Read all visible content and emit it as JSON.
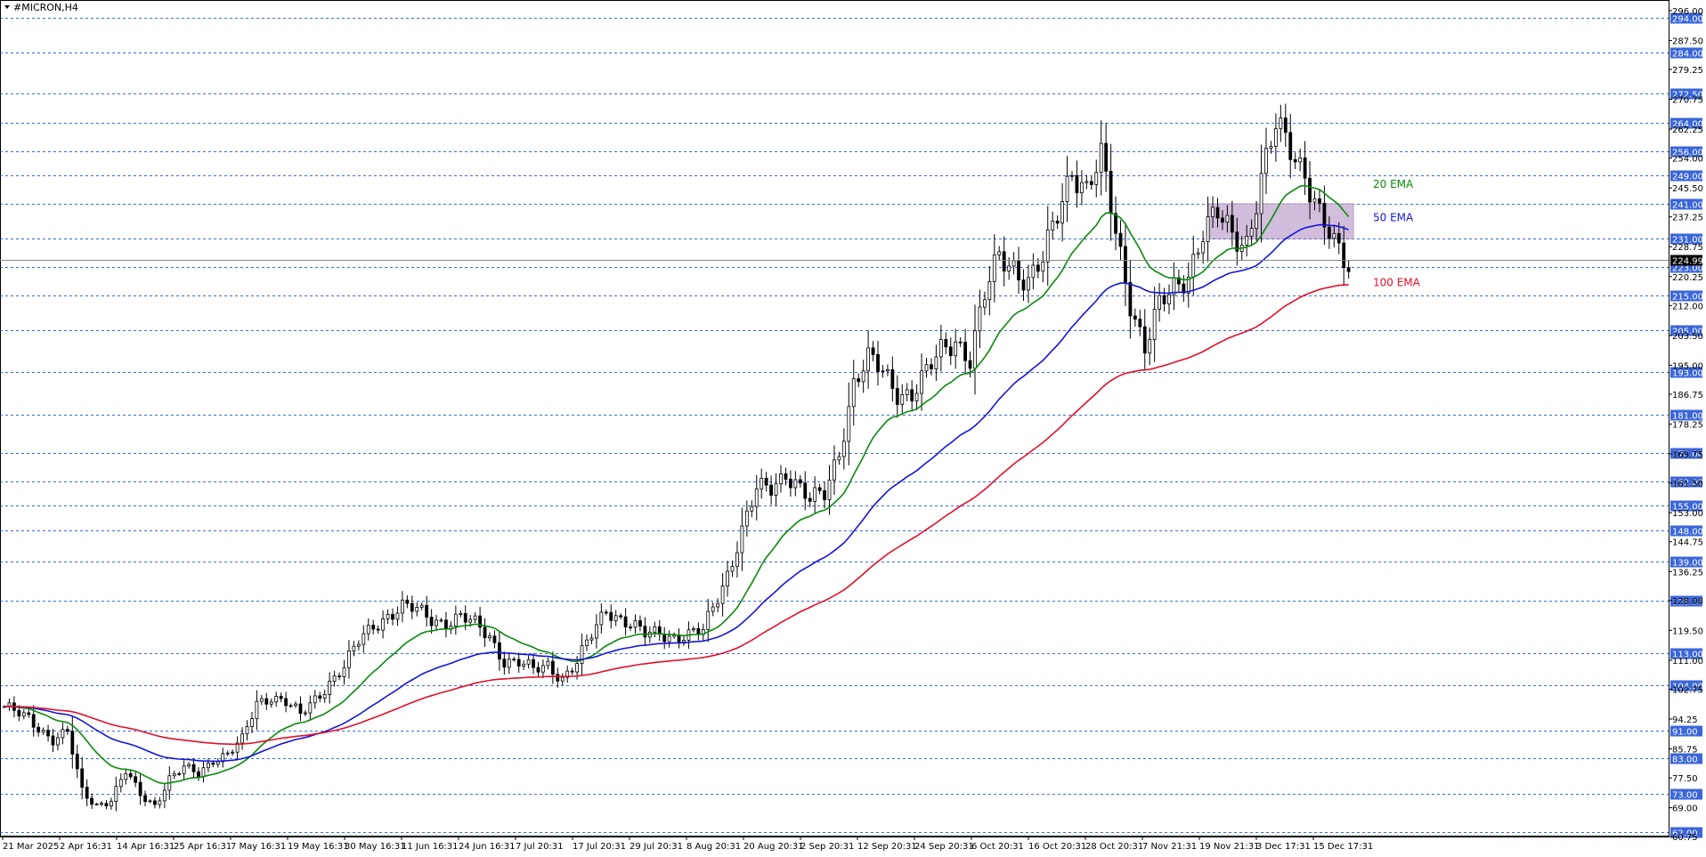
{
  "window": {
    "title": "#MICRON,H4",
    "menu_icon": "triangle-down-icon"
  },
  "colors": {
    "background": "#ffffff",
    "grid_level": "#1f4fd6",
    "level_label_bg": "#3a66d8",
    "candle": "#000000",
    "ema20": "#0a8a0a",
    "ema50": "#1515d8",
    "ema100": "#e0102a",
    "zone_fill": "#c9b3d6",
    "zone_stroke": "#8a6aa0"
  },
  "chart_data": {
    "type": "candlestick",
    "symbol": "#MICRON",
    "timeframe": "H4",
    "ylim": [
      60.8,
      298.5
    ],
    "y_ticks": [
      "296.00",
      "287.50",
      "279.25",
      "270.75",
      "262.25",
      "254.00",
      "245.50",
      "237.25",
      "228.75",
      "220.25",
      "212.00",
      "203.50",
      "195.00",
      "186.75",
      "178.25",
      "169.75",
      "161.50",
      "153.00",
      "144.75",
      "136.25",
      "128.00",
      "119.50",
      "111.00",
      "102.75",
      "94.25",
      "85.75",
      "77.50",
      "69.00",
      "60.75"
    ],
    "levels": [
      "294.00",
      "284.00",
      "272.50",
      "264.00",
      "256.00",
      "249.00",
      "241.00",
      "231.00",
      "223.00",
      "215.00",
      "205.00",
      "193.00",
      "181.00",
      "170.00",
      "162.00",
      "155.00",
      "148.00",
      "139.00",
      "128.00",
      "113.00",
      "104.00",
      "91.00",
      "83.00",
      "73.00",
      "62.00"
    ],
    "current_price": "224.99",
    "x_ticks": [
      "21 Mar 2025",
      "2 Apr 16:31",
      "14 Apr 16:31",
      "25 Apr 16:31",
      "7 May 16:31",
      "19 May 16:31",
      "30 May 16:31",
      "11 Jun 16:31",
      "24 Jun 16:31",
      "7 Jul 20:31",
      "17 Jul 20:31",
      "29 Jul 20:31",
      "8 Aug 20:31",
      "20 Aug 20:31",
      "2 Sep 20:31",
      "12 Sep 20:31",
      "24 Sep 20:31",
      "6 Oct 20:31",
      "16 Oct 20:31",
      "28 Oct 20:31",
      "7 Nov 21:31",
      "19 Nov 21:31",
      "3 Dec 17:31",
      "15 Dec 17:31"
    ],
    "price_path": [
      [
        0,
        97
      ],
      [
        5,
        95
      ],
      [
        10,
        88
      ],
      [
        13,
        90
      ],
      [
        16,
        74
      ],
      [
        19,
        70
      ],
      [
        22,
        71
      ],
      [
        25,
        79
      ],
      [
        28,
        73
      ],
      [
        31,
        70
      ],
      [
        34,
        77
      ],
      [
        37,
        80
      ],
      [
        40,
        79
      ],
      [
        43,
        83
      ],
      [
        46,
        84
      ],
      [
        49,
        88
      ],
      [
        52,
        99
      ],
      [
        55,
        101
      ],
      [
        58,
        99
      ],
      [
        61,
        95
      ],
      [
        64,
        100
      ],
      [
        67,
        105
      ],
      [
        70,
        109
      ],
      [
        73,
        116
      ],
      [
        76,
        121
      ],
      [
        79,
        124
      ],
      [
        82,
        126
      ],
      [
        85,
        125
      ],
      [
        88,
        123
      ],
      [
        91,
        122
      ],
      [
        94,
        123
      ],
      [
        97,
        121
      ],
      [
        100,
        118
      ],
      [
        103,
        111
      ],
      [
        106,
        110
      ],
      [
        109,
        108
      ],
      [
        112,
        110
      ],
      [
        115,
        106
      ],
      [
        118,
        110
      ],
      [
        121,
        118
      ],
      [
        124,
        126
      ],
      [
        126,
        124
      ],
      [
        129,
        121
      ],
      [
        132,
        118
      ],
      [
        135,
        119
      ],
      [
        138,
        118
      ],
      [
        141,
        118
      ],
      [
        144,
        119
      ],
      [
        146,
        126
      ],
      [
        149,
        136
      ],
      [
        152,
        148
      ],
      [
        155,
        159
      ],
      [
        158,
        160
      ],
      [
        161,
        165
      ],
      [
        163,
        162
      ],
      [
        166,
        156
      ],
      [
        169,
        158
      ],
      [
        172,
        171
      ],
      [
        175,
        190
      ],
      [
        178,
        196
      ],
      [
        181,
        193
      ],
      [
        184,
        188
      ],
      [
        187,
        187
      ],
      [
        190,
        192
      ],
      [
        193,
        199
      ],
      [
        196,
        203
      ],
      [
        199,
        197
      ],
      [
        202,
        214
      ],
      [
        205,
        226
      ],
      [
        208,
        224
      ],
      [
        211,
        219
      ],
      [
        214,
        224
      ],
      [
        217,
        238
      ],
      [
        220,
        252
      ],
      [
        223,
        245
      ],
      [
        226,
        253
      ],
      [
        229,
        233
      ],
      [
        232,
        214
      ],
      [
        235,
        200
      ],
      [
        238,
        211
      ],
      [
        241,
        217
      ],
      [
        244,
        222
      ],
      [
        247,
        233
      ],
      [
        250,
        237
      ],
      [
        253,
        232
      ],
      [
        256,
        231
      ],
      [
        259,
        248
      ],
      [
        262,
        262
      ],
      [
        265,
        257
      ],
      [
        268,
        251
      ],
      [
        271,
        238
      ],
      [
        274,
        228
      ],
      [
        277,
        223
      ]
    ],
    "n_candles": 278,
    "series": [
      {
        "name": "20 EMA",
        "color": "#0a8a0a",
        "period": 20
      },
      {
        "name": "50 EMA",
        "color": "#1515d8",
        "period": 50
      },
      {
        "name": "100 EMA",
        "color": "#e0102a",
        "period": 100
      }
    ],
    "zone": {
      "from_candle": 248,
      "to_candle": 278,
      "low": 231,
      "high": 241
    }
  }
}
